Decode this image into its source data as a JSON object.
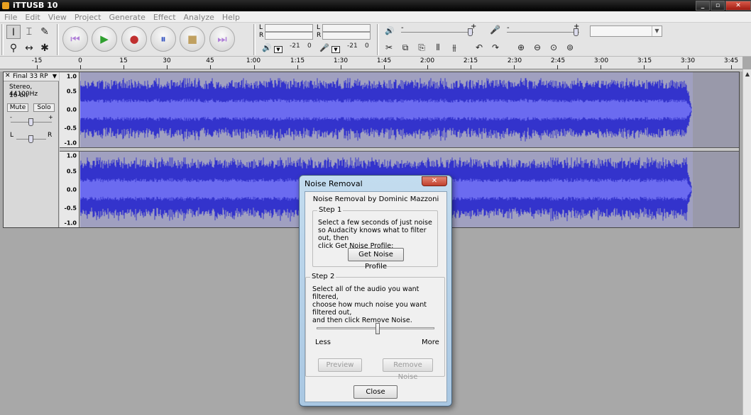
{
  "window": {
    "title": "iTTUSB 10",
    "controls": [
      "_",
      "▫",
      "✕"
    ]
  },
  "menu": [
    "File",
    "Edit",
    "View",
    "Project",
    "Generate",
    "Effect",
    "Analyze",
    "Help"
  ],
  "tools": {
    "selection": "I",
    "envelope": "⌶",
    "draw": "✎",
    "zoom": "⚲",
    "timeshift": "↔",
    "multi": "✱"
  },
  "transport": {
    "skip_start": "⏮",
    "play": "▶",
    "record": "●",
    "pause": "⏸",
    "stop": "■",
    "skip_end": "⏭"
  },
  "meters": {
    "left_label": "L",
    "right_label": "R",
    "play_scale_db": "-21",
    "play_scale_zero": "0",
    "rec_scale_db": "-21",
    "rec_scale_zero": "0",
    "playback_icon": "🔊",
    "record_icon": "🎤"
  },
  "mixer": {
    "volume_minus": "-",
    "volume_plus": "+",
    "mic_minus": "-",
    "mic_plus": "+",
    "input_source_value": ""
  },
  "edit_tools": [
    "✂",
    "⧉",
    "⎘",
    "⫴",
    "⫵",
    "↶",
    "↷",
    "⊕",
    "⊖",
    "⊙",
    "⊚"
  ],
  "ruler": {
    "labels": [
      "-15",
      "0",
      "15",
      "30",
      "45",
      "1:00",
      "1:15",
      "1:30",
      "1:45",
      "2:00",
      "2:15",
      "2:30",
      "2:45",
      "3:00",
      "3:15",
      "3:30",
      "3:45"
    ]
  },
  "track": {
    "close": "✕",
    "name": "Final 33 RP",
    "dropdown": "▼",
    "format": "Stereo, 44100Hz",
    "bitdepth": "16-bit",
    "mute": "Mute",
    "solo": "Solo",
    "gain_minus": "-",
    "gain_plus": "+",
    "pan_left": "L",
    "pan_right": "R",
    "scale": [
      "1.0",
      "0.5",
      "0.0",
      "-0.5",
      "-1.0"
    ]
  },
  "dialog": {
    "title": "Noise Removal",
    "close": "✕",
    "heading": "Noise Removal by Dominic Mazzoni",
    "step1_label": "Step 1",
    "step1_text": "Select a few seconds of just noise\nso Audacity knows what to filter out, then\nclick Get Noise Profile:",
    "get_profile": "Get Noise Profile",
    "step2_label": "Step 2",
    "step2_text": "Select all of the audio you want filtered,\nchoose how much noise you want filtered out,\nand then click Remove Noise.",
    "less": "Less",
    "more": "More",
    "slider_level": 0.52,
    "preview": "Preview",
    "remove": "Remove Noise",
    "close_btn": "Close"
  },
  "colors": {
    "waveform": "#3333cc",
    "waveform_rms": "#6b6bf0",
    "track_bg": "#9999aa"
  }
}
